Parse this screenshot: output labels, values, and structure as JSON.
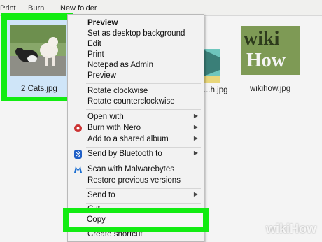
{
  "toolbar": {
    "print": "Print",
    "burn": "Burn",
    "new_folder": "New folder"
  },
  "files": [
    {
      "name": "2 Cats.jpg"
    },
    {
      "name": "...h.jpg"
    },
    {
      "name": "wikihow.jpg"
    }
  ],
  "thumb_text": {
    "line1": "wiki",
    "line2": "How"
  },
  "context_menu": {
    "preview_bold": "Preview",
    "set_desktop": "Set as desktop background",
    "edit": "Edit",
    "print": "Print",
    "notepad_admin": "Notepad as Admin",
    "preview": "Preview",
    "rotate_cw": "Rotate clockwise",
    "rotate_ccw": "Rotate counterclockwise",
    "open_with": "Open with",
    "burn_nero": "Burn with Nero",
    "add_shared_album": "Add to a shared album",
    "send_bluetooth": "Send by Bluetooth to",
    "scan_malwarebytes": "Scan with Malwarebytes",
    "restore_versions": "Restore previous versions",
    "send_to": "Send to",
    "cut_partial": "Cut",
    "copy": "Copy",
    "create_shortcut": "Create shortcut"
  },
  "highlight_color": "#12ec12",
  "watermark": "wikiHow"
}
